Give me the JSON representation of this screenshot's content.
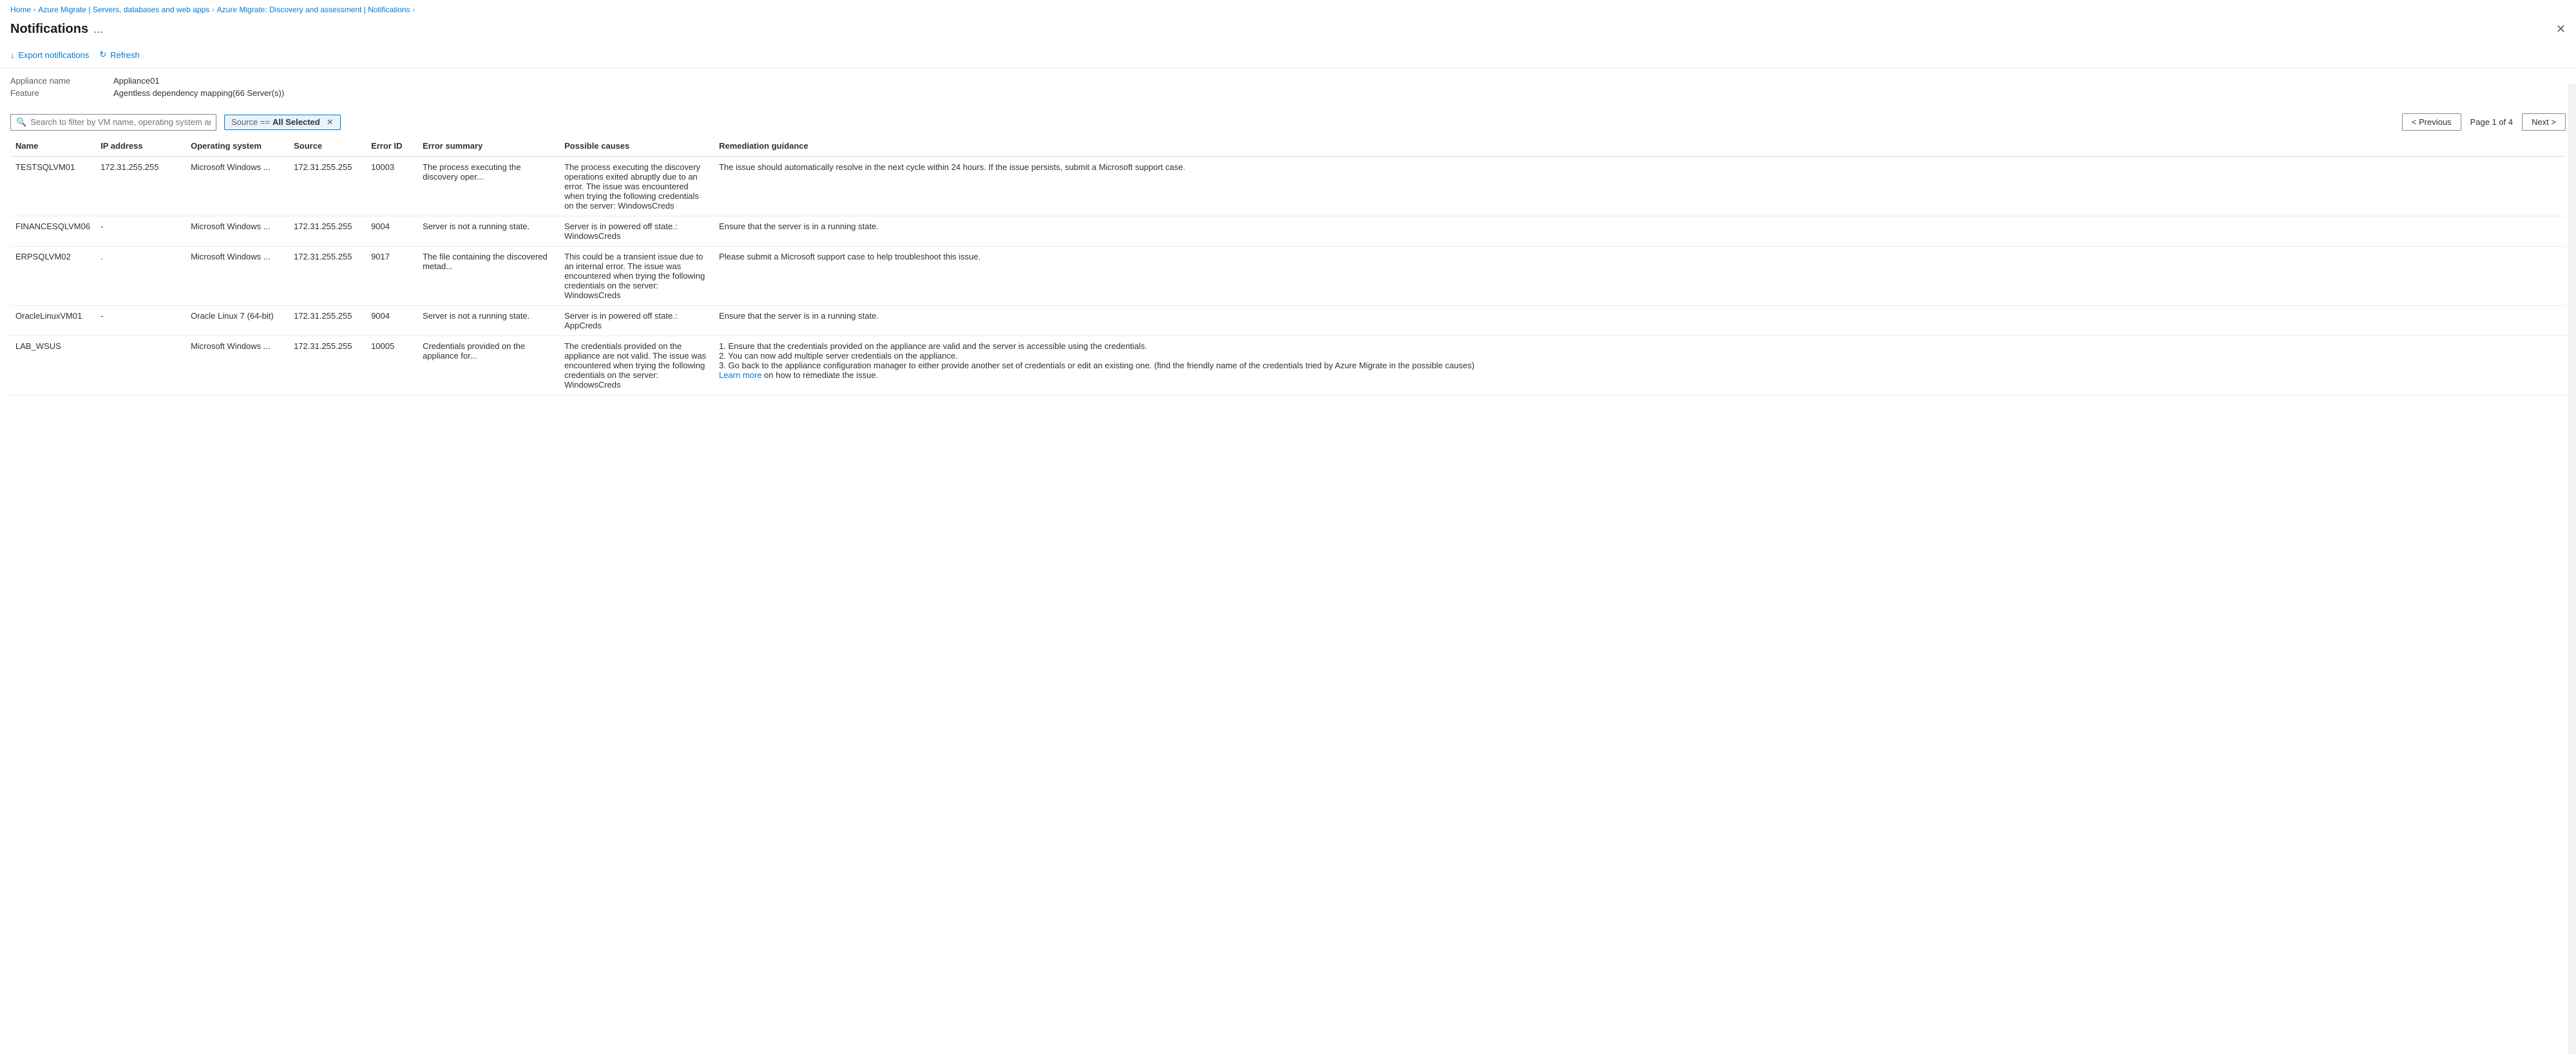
{
  "breadcrumb": {
    "items": [
      {
        "label": "Home",
        "active": true
      },
      {
        "label": "Azure Migrate | Servers, databases and web apps",
        "active": true
      },
      {
        "label": "Azure Migrate: Discovery and assessment | Notifications",
        "active": true
      }
    ]
  },
  "header": {
    "title": "Notifications",
    "more_label": "...",
    "close_label": "✕"
  },
  "toolbar": {
    "export_label": "Export notifications",
    "refresh_label": "Refresh"
  },
  "metadata": {
    "appliance_label": "Appliance name",
    "appliance_value": "Appliance01",
    "feature_label": "Feature",
    "feature_value": "Agentless dependency mapping(66 Server(s))"
  },
  "search": {
    "placeholder": "Search to filter by VM name, operating system and error ID"
  },
  "filter_badge": {
    "prefix": "Source ==",
    "value": "All Selected"
  },
  "pagination": {
    "previous_label": "< Previous",
    "next_label": "Next >",
    "page_info": "Page 1 of 4"
  },
  "table": {
    "headers": [
      "Name",
      "IP address",
      "Operating system",
      "Source",
      "Error ID",
      "Error summary",
      "Possible causes",
      "Remediation guidance"
    ],
    "rows": [
      {
        "name": "TESTSQLVM01",
        "ip": "172.31.255.255",
        "os": "Microsoft Windows ...",
        "source": "172.31.255.255",
        "error_id": "10003",
        "error_summary": "The process executing the discovery oper...",
        "possible_causes": "The process executing the discovery operations exited abruptly due to an error. The issue was encountered when trying the following credentials on the server: WindowsCreds",
        "remediation": "The issue should automatically resolve in the next cycle within 24 hours. If the issue persists, submit a Microsoft support case."
      },
      {
        "name": "FINANCESQLVM06",
        "ip": "-",
        "os": "Microsoft Windows ...",
        "source": "172.31.255.255",
        "error_id": "9004",
        "error_summary": "Server is not a running state.",
        "possible_causes": "Server is in powered off state.: WindowsCreds",
        "remediation": "Ensure that the server is in a running state."
      },
      {
        "name": "ERPSQLVM02",
        "ip": ".",
        "os": "Microsoft Windows ...",
        "source": "172.31.255.255",
        "error_id": "9017",
        "error_summary": "The file containing the discovered metad...",
        "possible_causes": "This could be a transient issue due to an internal error. The issue was encountered when trying the following credentials on the server: WindowsCreds",
        "remediation": "Please submit a Microsoft support case to help troubleshoot this issue."
      },
      {
        "name": "OracleLinuxVM01",
        "ip": "-",
        "os": "Oracle Linux 7 (64-bit)",
        "source": "172.31.255.255",
        "error_id": "9004",
        "error_summary": "Server is not a running state.",
        "possible_causes": "Server is in powered off state.: AppCreds",
        "remediation": "Ensure that the server is in a running state."
      },
      {
        "name": "LAB_WSUS",
        "ip": "",
        "os": "Microsoft Windows ...",
        "source": "172.31.255.255",
        "error_id": "10005",
        "error_summary": "Credentials provided on the appliance for...",
        "possible_causes": "The credentials provided on the appliance are not valid. The issue was encountered when trying the following credentials on the server: WindowsCreds",
        "remediation": "1. Ensure that the credentials provided on the appliance are valid and the server is accessible using the credentials.\n2. You can now add multiple server credentials on the appliance.\n3. Go back to the appliance configuration manager to either provide another set of credentials or edit an existing one. (find the friendly name of the credentials tried by Azure Migrate in the possible causes)",
        "remediation_link": "Learn more",
        "remediation_link_suffix": " on how to remediate the issue."
      }
    ]
  }
}
